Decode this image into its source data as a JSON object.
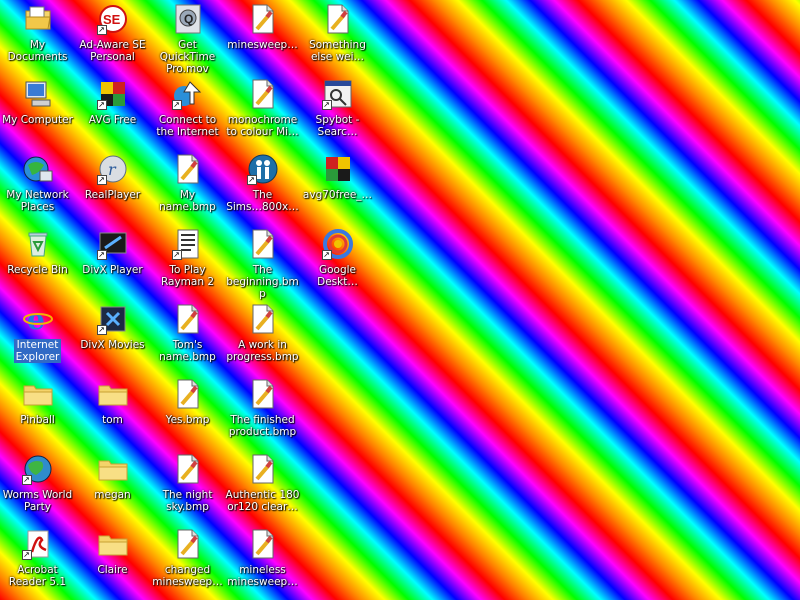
{
  "desktop": {
    "icons": [
      {
        "label": "My Documents",
        "icon": "my-documents-icon",
        "shortcut": false
      },
      {
        "label": "My Computer",
        "icon": "my-computer-icon",
        "shortcut": false
      },
      {
        "label": "My Network\nPlaces",
        "icon": "network-places-icon",
        "shortcut": false
      },
      {
        "label": "Recycle Bin",
        "icon": "recycle-bin-icon",
        "shortcut": false
      },
      {
        "label": "Internet\nExplorer",
        "icon": "internet-explorer-icon",
        "shortcut": false,
        "selected": true
      },
      {
        "label": "Pinball",
        "icon": "folder-icon",
        "shortcut": false
      },
      {
        "label": "Worms World\nParty",
        "icon": "worms-globe-icon",
        "shortcut": true
      },
      {
        "label": "Acrobat\nReader 5.1",
        "icon": "acrobat-reader-icon",
        "shortcut": true
      },
      {
        "label": "Ad-Aware SE\nPersonal",
        "icon": "ad-aware-icon",
        "shortcut": true
      },
      {
        "label": "AVG Free",
        "icon": "avg-icon",
        "shortcut": true
      },
      {
        "label": "RealPlayer",
        "icon": "realplayer-icon",
        "shortcut": true
      },
      {
        "label": "DivX Player",
        "icon": "divx-player-icon",
        "shortcut": true
      },
      {
        "label": "DivX Movies",
        "icon": "divx-movies-icon",
        "shortcut": true
      },
      {
        "label": "tom",
        "icon": "folder-icon",
        "shortcut": false
      },
      {
        "label": "megan",
        "icon": "folder-icon",
        "shortcut": false
      },
      {
        "label": "Claire",
        "icon": "folder-icon",
        "shortcut": false
      },
      {
        "label": "Get QuickTime\nPro.mov",
        "icon": "quicktime-icon",
        "shortcut": false
      },
      {
        "label": "Connect to\nthe Internet",
        "icon": "connect-internet-icon",
        "shortcut": true
      },
      {
        "label": "My name.bmp",
        "icon": "bitmap-file-icon",
        "shortcut": false
      },
      {
        "label": "To Play\nRayman 2",
        "icon": "text-file-icon",
        "shortcut": true
      },
      {
        "label": "Tom's\nname.bmp",
        "icon": "bitmap-file-icon",
        "shortcut": false
      },
      {
        "label": "Yes.bmp",
        "icon": "bitmap-file-icon",
        "shortcut": false
      },
      {
        "label": "The night\nsky.bmp",
        "icon": "bitmap-file-icon",
        "shortcut": false
      },
      {
        "label": "changed\nminesweep…",
        "icon": "bitmap-file-icon",
        "shortcut": false
      },
      {
        "label": "minesweep…",
        "icon": "bitmap-file-icon",
        "shortcut": false
      },
      {
        "label": "monochrome\nto colour Mi…",
        "icon": "bitmap-file-icon",
        "shortcut": false
      },
      {
        "label": "The\nSims…800x…",
        "icon": "sims-icon",
        "shortcut": true
      },
      {
        "label": "The\nbeginning.bmp",
        "icon": "bitmap-file-icon",
        "shortcut": false
      },
      {
        "label": "A work in\nprogress.bmp",
        "icon": "bitmap-file-icon",
        "shortcut": false
      },
      {
        "label": "The finished\nproduct.bmp",
        "icon": "bitmap-file-icon",
        "shortcut": false
      },
      {
        "label": "Authentic 180\nor120 clear…",
        "icon": "bitmap-file-icon",
        "shortcut": false
      },
      {
        "label": "mineless\nminesweep…",
        "icon": "bitmap-file-icon",
        "shortcut": false
      },
      {
        "label": "Something\nelse wei…",
        "icon": "bitmap-file-icon",
        "shortcut": false
      },
      {
        "label": "Spybot -\nSearc…",
        "icon": "spybot-icon",
        "shortcut": true
      },
      {
        "label": "avg70free_…",
        "icon": "avg-installer-icon",
        "shortcut": false
      },
      {
        "label": "Google\nDeskt…",
        "icon": "google-desktop-icon",
        "shortcut": true
      }
    ]
  }
}
